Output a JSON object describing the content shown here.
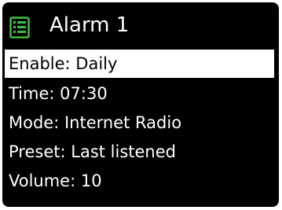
{
  "header": {
    "title": "Alarm 1",
    "icon": "list-icon",
    "icon_color": "#3fbf3f"
  },
  "menu": {
    "items": [
      {
        "label": "Enable",
        "value": "Daily",
        "selected": true
      },
      {
        "label": "Time",
        "value": "07:30",
        "selected": false
      },
      {
        "label": "Mode",
        "value": "Internet Radio",
        "selected": false
      },
      {
        "label": "Preset",
        "value": "Last listened",
        "selected": false
      },
      {
        "label": "Volume",
        "value": "10",
        "selected": false
      }
    ]
  },
  "colors": {
    "background": "#000000",
    "text": "#ffffff",
    "highlight_bg": "#ffffff",
    "highlight_text": "#000000"
  }
}
